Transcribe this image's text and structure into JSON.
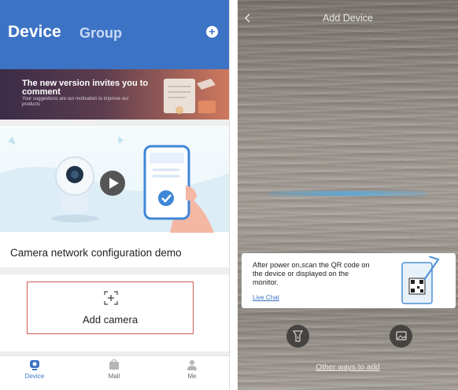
{
  "left_screen": {
    "header": {
      "tab_device": "Device",
      "tab_group": "Group",
      "add_icon": "plus-circle-icon",
      "accent_color": "#3d73c5"
    },
    "banner": {
      "title": "The new version invites you to comment",
      "subtitle": "Your suggestions are our motivation to improve our products"
    },
    "demo": {
      "caption": "Camera network configuration demo"
    },
    "add_camera": {
      "label": "Add camera",
      "icon": "add-scan-icon",
      "border_color": "#cf5a52"
    },
    "bottom_nav": [
      {
        "label": "Device",
        "icon": "device-icon",
        "active": true
      },
      {
        "label": "Mall",
        "icon": "mall-icon",
        "active": false
      },
      {
        "label": "Me",
        "icon": "person-icon",
        "active": false
      }
    ]
  },
  "right_screen": {
    "title": "Add Device",
    "back_icon": "chevron-left-icon",
    "instruction": "After power on,scan the QR code on the device or displayed on the monitor.",
    "live_chat": "Live Chat",
    "flashlight_icon": "flashlight-icon",
    "gallery_icon": "gallery-icon",
    "other_ways": "Other ways to add"
  }
}
